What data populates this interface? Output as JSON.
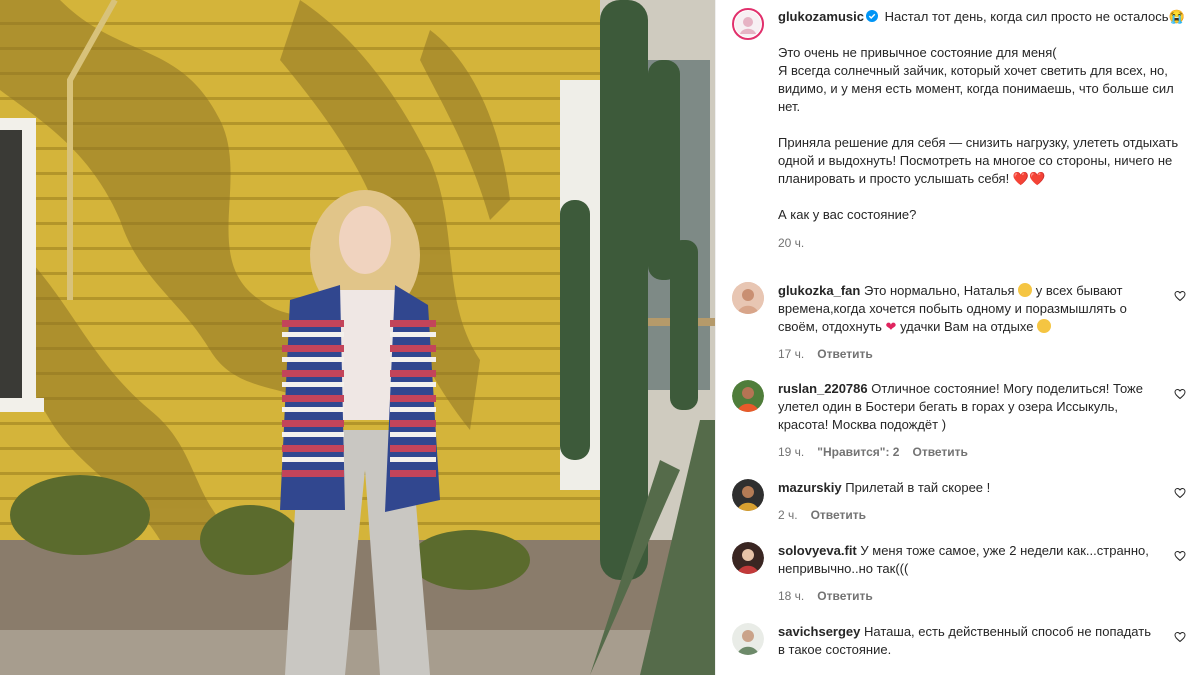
{
  "post": {
    "author": "glukozamusic",
    "caption": [
      "Настал тот день, когда сил просто не осталось😭",
      "Это очень не привычное состояние для меня(\nЯ всегда солнечный зайчик, который хочет светить для всех, но, видимо, и у меня есть момент, когда понимаешь, что больше сил нет.",
      "Приняла решение для себя — снизить нагрузку, улететь отдыхать одной и выдохнуть! Посмотреть на многое со стороны, ничего не планировать и просто услышать себя! ❤️❤️",
      "А как у вас состояние?"
    ],
    "time": "20 ч."
  },
  "comments": [
    {
      "user": "glukozka_fan",
      "parts": [
        "Это нормально, Наталья ",
        "☺",
        " у всех бывают времена,когда хочется побыть одному и поразмышлять о своём, отдохнуть ",
        "❤",
        " удачки Вам на отдыхе ",
        "😊"
      ],
      "time": "17 ч.",
      "likes": "",
      "reply": "Ответить"
    },
    {
      "user": "ruslan_220786",
      "parts": [
        "Отличное состояние! Могу поделиться! Тоже улетел один в Бостери бегать в горах у озера Иссыкуль, красота! Москва подождёт )"
      ],
      "time": "19 ч.",
      "likes": "\"Нравится\": 2",
      "reply": "Ответить"
    },
    {
      "user": "mazurskiy",
      "parts": [
        "Прилетай в тай скорее !"
      ],
      "time": "2 ч.",
      "likes": "",
      "reply": "Ответить"
    },
    {
      "user": "solovyeva.fit",
      "parts": [
        "У меня тоже самое, уже 2 недели как...странно, непривычно..но так((("
      ],
      "time": "18 ч.",
      "likes": "",
      "reply": "Ответить"
    },
    {
      "user": "savichsergey",
      "parts": [
        "Наташа, есть действенный способ не попадать в такое состояние."
      ],
      "time": "",
      "likes": "",
      "reply": ""
    }
  ],
  "icons": {
    "verified": "verified-badge-icon",
    "like": "heart-outline-icon"
  },
  "colors": {
    "wall": "#d7b73c",
    "verified": "#0095f6",
    "meta": "#737373"
  }
}
